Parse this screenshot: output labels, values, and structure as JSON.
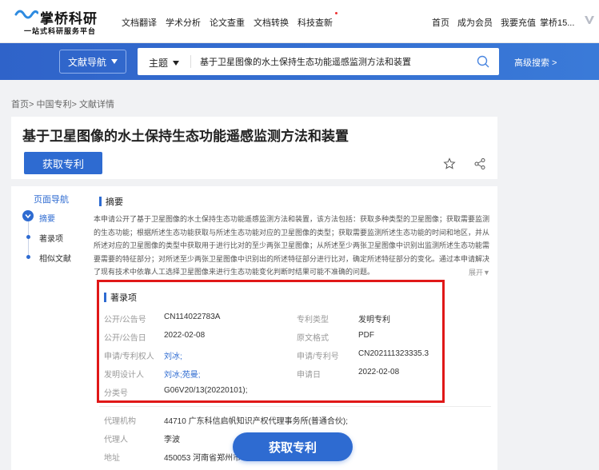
{
  "header": {
    "logo_name": "掌桥科研",
    "logo_slogan": "一站式科研服务平台",
    "nav": [
      "文档翻译",
      "学术分析",
      "论文查重",
      "文档转换",
      "科技查新"
    ],
    "right_links": [
      "首页",
      "成为会员",
      "我要充值"
    ],
    "user": "掌桥15..."
  },
  "search": {
    "nav_button": "文献导航",
    "scope": "主题",
    "query": "基于卫星图像的水土保持生态功能遥感监测方法和装置",
    "advanced": "高级搜索 >"
  },
  "breadcrumb": "首页> 中国专利> 文献详情",
  "title": "基于卫星图像的水土保持生态功能遥感监测方法和装置",
  "get_patent_label": "获取专利",
  "page_nav": {
    "title": "页面导航",
    "items": [
      "摘要",
      "著录项",
      "相似文献"
    ]
  },
  "abstract": {
    "heading": "摘要",
    "text": "本申请公开了基于卫星图像的水土保持生态功能遥感监测方法和装置，该方法包括：获取多种类型的卫星图像；获取需要监测的生态功能；根据所述生态功能获取与所述生态功能对应的卫星图像的类型；获取需要监测所述生态功能的时间和地区，并从所述对应的卫星图像的类型中获取用于进行比对的至少两张卫星图像；从所述至少两张卫星图像中识别出监测所述生态功能需要需要的特征部分；对所述至少两张卫星图像中识别出的所述特征部分进行比对，确定所述特征部分的变化。通过本申请解决了现有技术中依靠人工选择卫星图像来进行生态功能变化判断时结果可能不准确的问题。",
    "expand": "展开▼"
  },
  "bibliographic": {
    "heading": "著录项",
    "labels": {
      "pub_no": "公开/公告号",
      "pub_date": "公开/公告日",
      "applicant": "申请/专利权人",
      "inventor": "发明设计人",
      "classification": "分类号",
      "patent_type": "专利类型",
      "original_format": "原文格式",
      "app_no": "申请/专利号",
      "app_date": "申请日",
      "agency": "代理机构",
      "agent": "代理人",
      "address": "地址"
    },
    "values": {
      "pub_no": "CN114022783A",
      "pub_date": "2022-02-08",
      "applicant": "刘冰;",
      "inventor": "刘冰;苑曼;",
      "classification": "G06V20/13(20220101);",
      "patent_type": "发明专利",
      "original_format": "PDF",
      "app_no": "CN202111323335.3",
      "app_date": "2022-02-08",
      "agency": "44710 广东科信启帆知识产权代理事务所(普通合伙);",
      "agent": "李波",
      "address": "450053 河南省郑州市"
    }
  },
  "colors": {
    "primary": "#2e6bd1",
    "highlight": "#e01818",
    "band": "#3a72d4"
  }
}
